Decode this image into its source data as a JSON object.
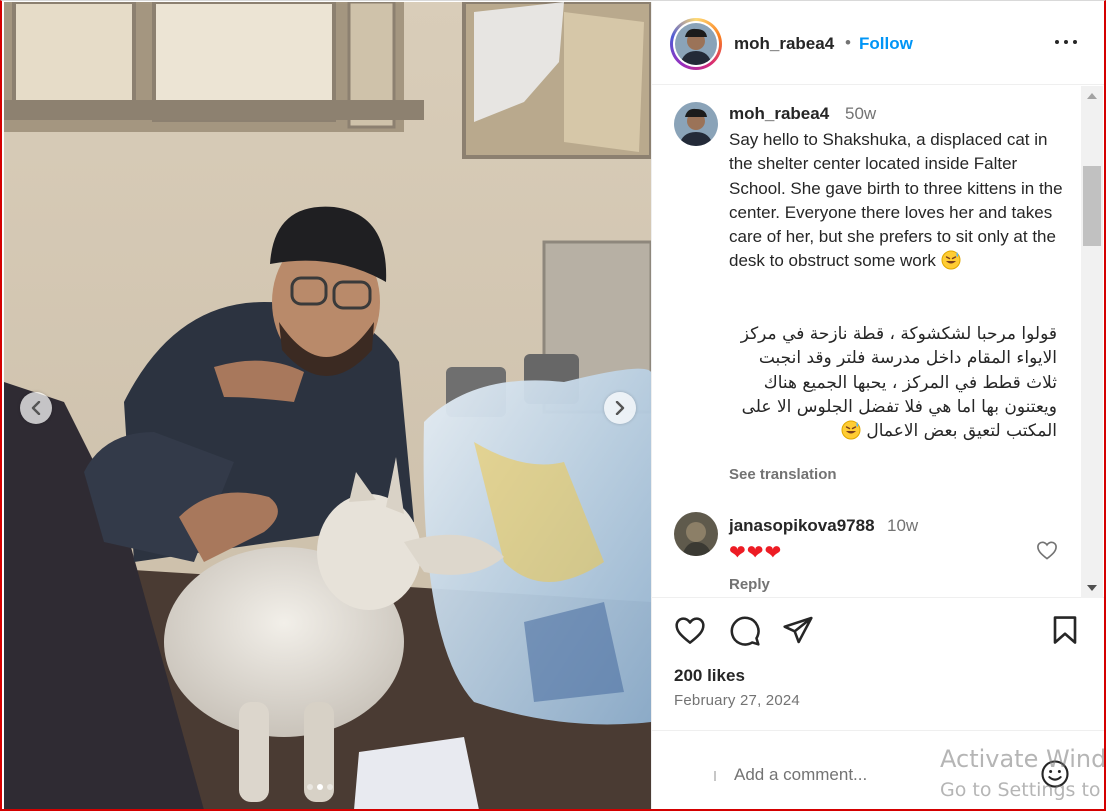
{
  "post": {
    "username": "moh_rabea4",
    "separator": "•",
    "follow_label": "Follow",
    "caption_time": "50w",
    "caption_en": "Say hello to Shakshuka, a displaced cat in the shelter center located inside Falter School. She gave birth to three kittens in the center. Everyone there loves her and takes care of her, but she prefers to sit only at the desk to obstruct some work",
    "caption_ar": "قولوا مرحبا لشكشوكة ، قطة نازحة في مركز الايواء المقام داخل مدرسة فلتر وقد انجبت ثلاث قطط في المركز ، يحبها الجميع هناك ويعتنون بها اما هي فلا تفضل الجلوس الا على المكتب لتعيق بعض الاعمال",
    "see_translation": "See translation",
    "likes": "200 likes",
    "date": "February 27, 2024",
    "add_comment_placeholder": "Add a comment..."
  },
  "carousel": {
    "slide_count": 3,
    "active_slide": 2
  },
  "comments": [
    {
      "username": "janasopikova9788",
      "time": "10w",
      "text": "❤❤❤",
      "reply_label": "Reply"
    }
  ],
  "icons": {
    "like": "heart-icon",
    "comment": "comment-icon",
    "share": "paper-plane-icon",
    "save": "bookmark-icon",
    "more": "more-options-icon",
    "emoji": "emoji-icon"
  },
  "colors": {
    "follow_blue": "#0095f6",
    "secondary_text": "#737373",
    "heart_red": "#ed1c24"
  },
  "watermark": {
    "line1": "Activate Windows",
    "line2": "Go to Settings to activate Windows."
  }
}
